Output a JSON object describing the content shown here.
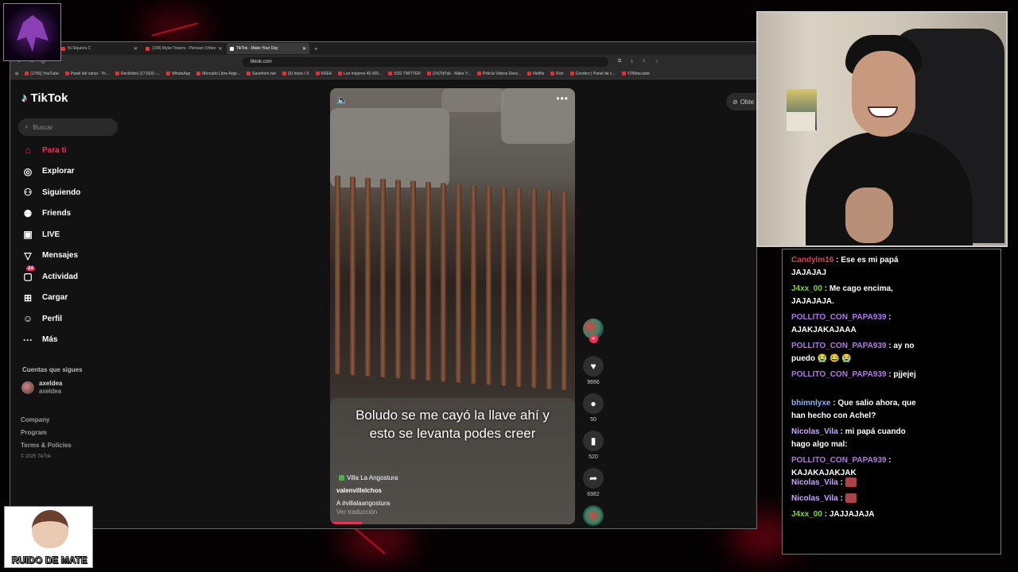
{
  "browser": {
    "tabs": [
      {
        "label": "Ni Siquiera C"
      },
      {
        "label": "(158) Myke Towers - Piensan (Video"
      },
      {
        "label": "TikTok - Make Your Day"
      }
    ],
    "url": "tiktok.com",
    "bookmarks": [
      "(1756) YouTube",
      "Panel del canal - Yo...",
      "Recibidos (17,603) -...",
      "WhatsApp",
      "Mercado Libre Arge...",
      "Savefrom.net",
      "(9) Inicio / X",
      "KREA",
      "Los mejores 40.000...",
      "SSS TWITTER",
      "(24)TikTok - Make Y...",
      "Policía Videos Desc...",
      "Netflix",
      "Kick",
      "Cerebro | Panel de c...",
      "Y2Meta.tube"
    ]
  },
  "tiktok": {
    "logo": "TikTok",
    "search_placeholder": "Buscar",
    "nav": [
      {
        "label": "Para ti",
        "icon": "home-icon"
      },
      {
        "label": "Explorar",
        "icon": "compass-icon"
      },
      {
        "label": "Siguiendo",
        "icon": "user-follow-icon"
      },
      {
        "label": "Friends",
        "icon": "friends-icon"
      },
      {
        "label": "LIVE",
        "icon": "live-icon"
      },
      {
        "label": "Mensajes",
        "icon": "send-icon"
      },
      {
        "label": "Actividad",
        "icon": "inbox-icon",
        "badge": "24"
      },
      {
        "label": "Cargar",
        "icon": "upload-icon"
      },
      {
        "label": "Perfil",
        "icon": "profile-icon"
      },
      {
        "label": "Más",
        "icon": "more-icon"
      }
    ],
    "following_heading": "Cuentas que sigues",
    "following_account": {
      "name": "axeldea",
      "handle": "axeldea"
    },
    "footer": [
      "Company",
      "Program",
      "Terms & Policies"
    ],
    "copyright": "© 2025 TikTok",
    "get_app": "Obte",
    "video": {
      "caption": "Boludo se me cayó la llave ahí y esto se levanta podes creer",
      "location": "Villa La Angostura",
      "author": "valenvillelchos",
      "description": "A  #villalaangostura",
      "translate": "Ver traducción"
    },
    "actions": {
      "likes": "9666",
      "comments": "50",
      "saves": "520",
      "shares": "6982"
    }
  },
  "chat": [
    {
      "user": "Candylm16",
      "color": "#e0405a",
      "text": "Ese es mi papá JAJAJAJ"
    },
    {
      "user": "J4xx_00",
      "color": "#7cdc3c",
      "text": "Me cago encima, JAJAJAJA."
    },
    {
      "user": "POLLITO_CON_PAPA939",
      "color": "#b07ae8",
      "text": "AJAKJAKAJAAA"
    },
    {
      "user": "POLLITO_CON_PAPA939",
      "color": "#b07ae8",
      "text": "ay no puedo 😭 😂 😭"
    },
    {
      "user": "POLLITO_CON_PAPA939",
      "color": "#b07ae8",
      "text": "pjjejej"
    },
    {
      "user": "bhimnlyxe",
      "color": "#8fb2ff",
      "text": "Que salio ahora, que han hecho con Achel?"
    },
    {
      "user": "Nicolas_Vila",
      "color": "#c8a6ff",
      "text": "mi papá cuando hago algo mal:"
    },
    {
      "user": "POLLITO_CON_PAPA939",
      "color": "#b07ae8",
      "text": "KAJAKAJAKJAK"
    },
    {
      "user": "Nicolas_Vila",
      "color": "#c8a6ff",
      "text": ""
    },
    {
      "user": "Nicolas_Vila",
      "color": "#c8a6ff",
      "text": ""
    },
    {
      "user": "J4xx_00",
      "color": "#7cdc3c",
      "text": "JAJJAJAJA"
    }
  ],
  "overlay": {
    "mate_label": "RUIDO DE MATE"
  },
  "colors": {
    "accent": "#fe2c55",
    "stream_red": "#b3061a"
  }
}
